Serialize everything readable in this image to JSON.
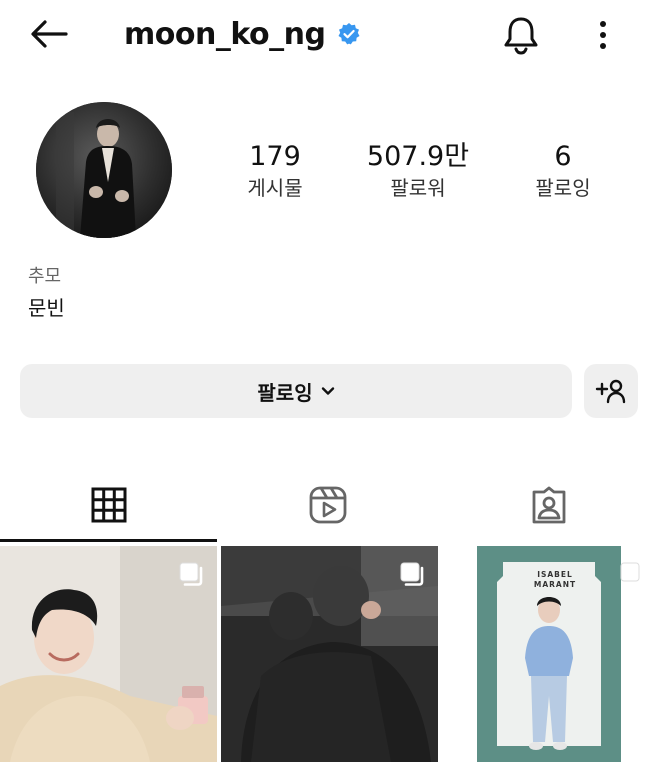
{
  "header": {
    "username": "moon_ko_ng"
  },
  "stats": [
    {
      "value": "179",
      "label": "게시물"
    },
    {
      "value": "507.9만",
      "label": "팔로워"
    },
    {
      "value": "6",
      "label": "팔로잉"
    }
  ],
  "bio": {
    "category": "추모",
    "name": "문빈"
  },
  "actions": {
    "follow_label": "팔로잉"
  },
  "photo3_sign": "ISABEL MARANT",
  "colors": {
    "verified": "#3897f0",
    "button_bg": "#efefef",
    "text": "#111111"
  }
}
